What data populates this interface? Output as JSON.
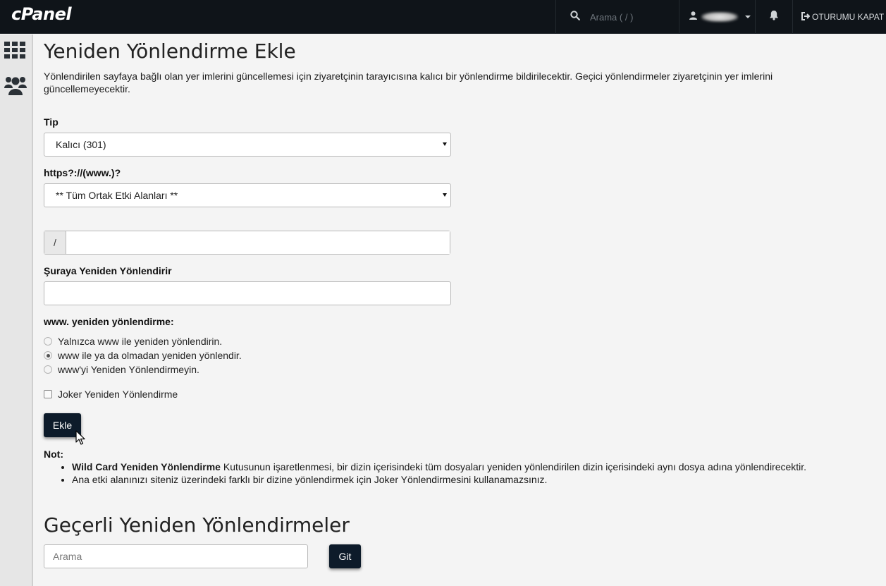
{
  "header": {
    "logo_text": "cPanel",
    "search_placeholder": "Arama ( / )",
    "logout_label": "OTURUMU KAPAT"
  },
  "sidebar": {
    "items": [
      {
        "icon": "grid-icon"
      },
      {
        "icon": "users-icon"
      }
    ]
  },
  "main": {
    "title": "Yeniden Yönlendirme Ekle",
    "description": "Yönlendirilen sayfaya bağlı olan yer imlerini güncellemesi için ziyaretçinin tarayıcısına kalıcı bir yönlendirme bildirilecektir. Geçici yönlendirmeler ziyaretçinin yer imlerini güncellemeyecektir.",
    "type_label": "Tip",
    "type_value": "Kalıcı (301)",
    "domain_label": "https?://(www.)?",
    "domain_value": "** Tüm Ortak Etki Alanları **",
    "path_prefix": "/",
    "path_value": "",
    "redirect_to_label": "Şuraya Yeniden Yönlendirir",
    "redirect_to_value": "",
    "www_label": "www. yeniden yönlendirme:",
    "www_options": [
      {
        "label": "Yalnızca www ile yeniden yönlendirin.",
        "checked": false
      },
      {
        "label": "www ile ya da olmadan yeniden yönlendir.",
        "checked": true
      },
      {
        "label": "www'yi Yeniden Yönlendirmeyin.",
        "checked": false
      }
    ],
    "wildcard_label": "Joker Yeniden Yönlendirme",
    "wildcard_checked": false,
    "add_button": "Ekle",
    "note_title": "Not:",
    "notes": [
      {
        "bold": "Wild Card Yeniden Yönlendirme",
        "text": " Kutusunun işaretlenmesi, bir dizin içerisindeki tüm dosyaları yeniden yönlendirilen dizin içerisindeki aynı dosya adına yönlendirecektir."
      },
      {
        "bold": "",
        "text": "Ana etki alanınızı siteniz üzerindeki farklı bir dizine yönlendirmek için Joker Yönlendirmesini kullanamazsınız."
      }
    ]
  },
  "current": {
    "title": "Geçerli Yeniden Yönlendirmeler",
    "search_placeholder": "Arama",
    "go_button": "Git"
  },
  "colors": {
    "topbar": "#0f1419",
    "button": "#0d1b2a",
    "background": "#f4f4f4"
  }
}
